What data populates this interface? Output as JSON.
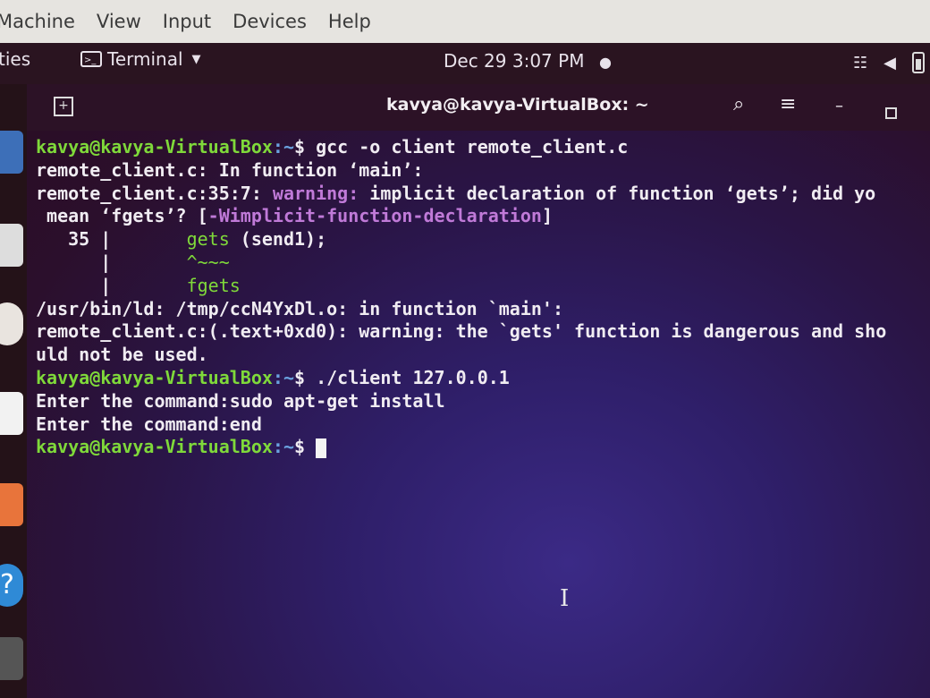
{
  "host_menu": [
    "Machine",
    "View",
    "Input",
    "Devices",
    "Help"
  ],
  "panel": {
    "activities": "ties",
    "app_menu_label": "Terminal",
    "clock": "Dec 29  3:07 PM",
    "tray_icons": [
      "network-icon",
      "volume-icon",
      "battery-icon"
    ]
  },
  "window": {
    "title": "kavya@kavya-VirtualBox: ~"
  },
  "terminal": {
    "lines": [
      {
        "user": "kavya@kavya-VirtualBox",
        "path": ":~",
        "cmd": "$ gcc -o client remote_client.c"
      },
      {
        "text": "remote_client.c: In function ‘main’:"
      },
      {
        "pre": "remote_client.c:35:7: ",
        "warn": "warning:",
        "post": " implicit declaration of function ‘gets’; did yo"
      },
      {
        "text": " mean ‘fgets’? [",
        "warn": "-Wimplicit-function-declaration",
        "post": "]"
      },
      {
        "text": "   35 |       ",
        "green": "gets",
        "post": " (send1);"
      },
      {
        "text": "      |       ",
        "green": "^~~~"
      },
      {
        "text": "      |       ",
        "green": "fgets"
      },
      {
        "text": "/usr/bin/ld: /tmp/ccN4YxDl.o: in function `main':"
      },
      {
        "text": "remote_client.c:(.text+0xd0): warning: the `gets' function is dangerous and sho"
      },
      {
        "text": "uld not be used."
      },
      {
        "user": "kavya@kavya-VirtualBox",
        "path": ":~",
        "cmd": "$ ./client 127.0.0.1"
      },
      {
        "text": "Enter the command:sudo apt-get install"
      },
      {
        "text": "Enter the command:end"
      },
      {
        "user": "kavya@kavya-VirtualBox",
        "path": ":~",
        "cmd": "$ ",
        "cursor": true
      }
    ]
  }
}
